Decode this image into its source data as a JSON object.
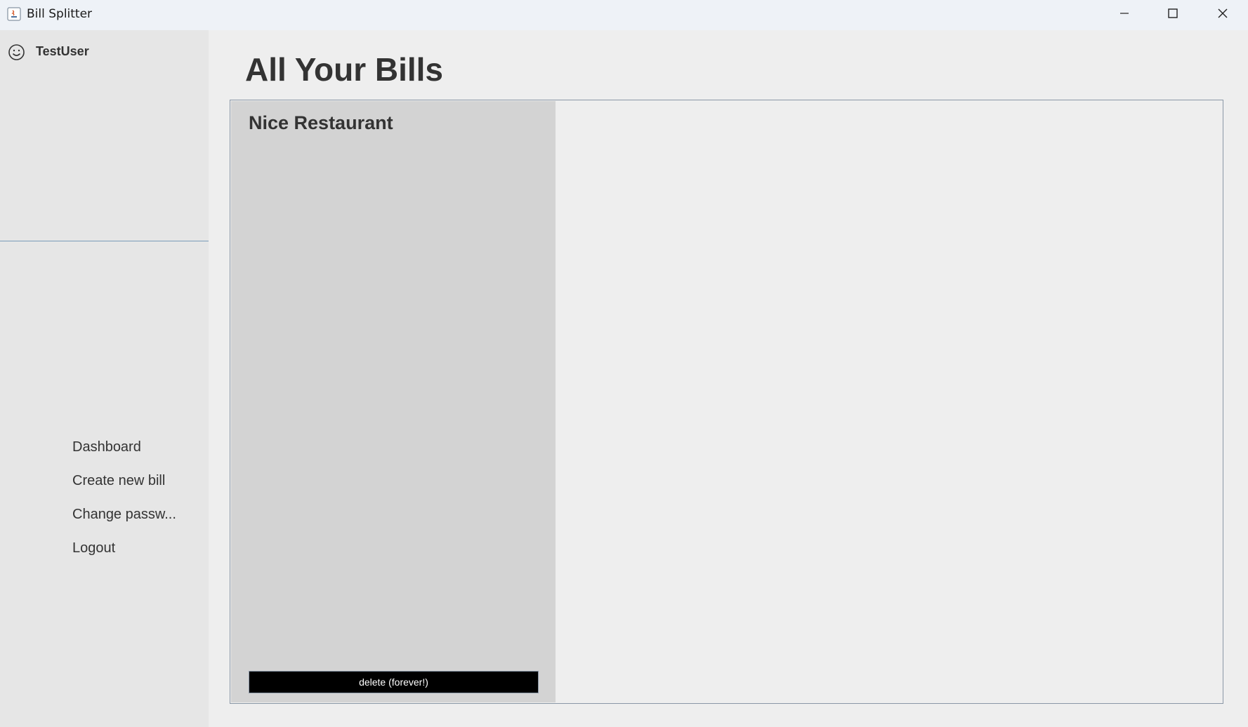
{
  "window": {
    "title": "Bill Splitter",
    "controls": {
      "minimize_icon": "minimize-icon",
      "maximize_icon": "maximize-icon",
      "close_icon": "close-icon"
    }
  },
  "sidebar": {
    "user": {
      "icon": "smiley-icon",
      "name": "TestUser"
    },
    "nav": [
      {
        "label": "Dashboard"
      },
      {
        "label": "Create new bill"
      },
      {
        "label": "Change passw..."
      },
      {
        "label": "Logout"
      }
    ]
  },
  "main": {
    "title": "All Your Bills",
    "bills": [
      {
        "name": "Nice Restaurant",
        "delete_label": "delete (forever!)"
      }
    ]
  },
  "colors": {
    "background": "#eeeeee",
    "sidebar": "#e6e6e6",
    "card": "#d3d3d3",
    "text": "#333333",
    "delete_button": "#000000",
    "divider": "#7a9cb8"
  }
}
